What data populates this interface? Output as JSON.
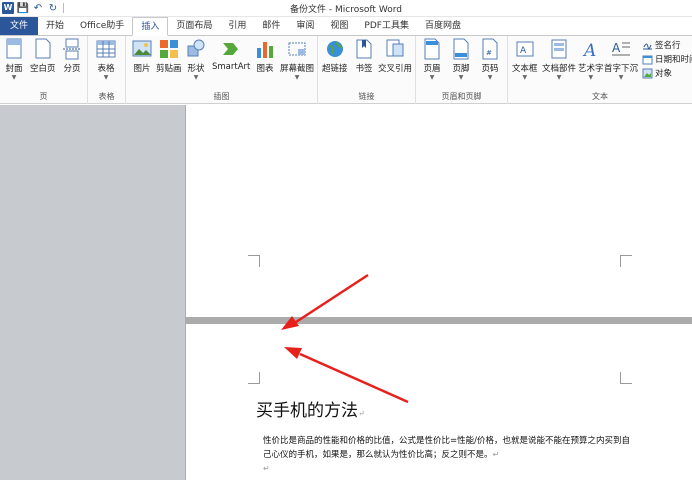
{
  "window": {
    "title": "备份文件 - Microsoft Word"
  },
  "quick_access": {
    "logo": "W",
    "save_icon": "💾",
    "undo_icon": "↶",
    "redo_icon": "↻"
  },
  "tabs": [
    {
      "label": "文件"
    },
    {
      "label": "开始"
    },
    {
      "label": "Office助手"
    },
    {
      "label": "插入"
    },
    {
      "label": "页面布局"
    },
    {
      "label": "引用"
    },
    {
      "label": "邮件"
    },
    {
      "label": "审阅"
    },
    {
      "label": "视图"
    },
    {
      "label": "PDF工具集"
    },
    {
      "label": "百度网盘"
    }
  ],
  "ribbon": {
    "groups": {
      "pages": "页",
      "tables": "表格",
      "illustrations": "插图",
      "links": "链接",
      "header_footer": "页眉和页脚",
      "text": "文本"
    },
    "buttons": {
      "cover": "封面",
      "blank_page": "空白页",
      "page_break": "分页",
      "table": "表格",
      "picture": "图片",
      "clip_art": "剪贴画",
      "shapes": "形状",
      "smartart": "SmartArt",
      "chart": "图表",
      "screenshot": "屏幕截图",
      "hyperlink": "超链接",
      "bookmark": "书签",
      "cross_reference": "交叉引用",
      "header": "页眉",
      "footer": "页脚",
      "page_number": "页码",
      "text_box": "文本框",
      "quick_parts": "文档部件",
      "wordart": "艺术字",
      "drop_cap": "首字下沉",
      "signature_line": "签名行",
      "date_time": "日期和时间",
      "object": "对象"
    }
  },
  "document": {
    "title": "买手机的方法",
    "paragraph1": "性价比是商品的性能和价格的比值，公式是性价比=性能/价格，也就是说能不能在预算之内买到自己心仪的手机，如果是，那么就认为性价比高；反之则不是。",
    "para_mark": "↵"
  },
  "colors": {
    "accent": "#2b579a",
    "arrow": "#e8201b",
    "workspace": "#ababab"
  }
}
